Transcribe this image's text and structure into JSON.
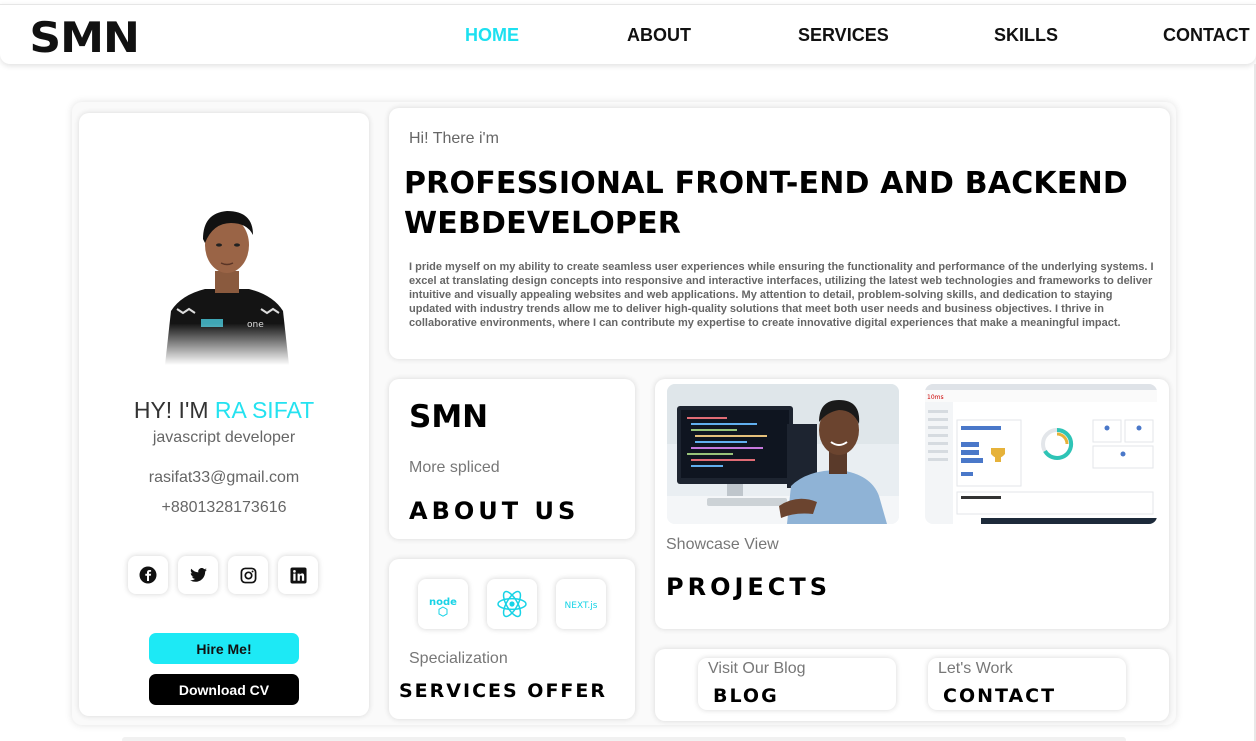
{
  "header": {
    "logo": "SMN",
    "nav": [
      {
        "label": "HOME",
        "active": true
      },
      {
        "label": "ABOUT",
        "active": false
      },
      {
        "label": "SERVICES",
        "active": false
      },
      {
        "label": "SKILLS",
        "active": false
      },
      {
        "label": "CONTACT",
        "active": false
      }
    ]
  },
  "profile": {
    "greeting_prefix": "HY! I'M ",
    "name": "RA SIFAT",
    "role": "javascript developer",
    "email": "rasifat33@gmail.com",
    "phone": "+8801328173616",
    "socials": [
      "facebook-icon",
      "twitter-icon",
      "instagram-icon",
      "linkedin-icon"
    ],
    "hire_label": "Hire Me!",
    "cv_label": "Download CV"
  },
  "intro": {
    "greeting": "Hi! There i'm",
    "headline": "PROFESSIONAL FRONT-END AND BACKEND WEBDEVELOPER",
    "bio": "I pride myself on my ability to create seamless user experiences while ensuring the functionality and performance of the underlying systems. I excel at translating design concepts into responsive and interactive interfaces, utilizing the latest web technologies and frameworks to deliver intuitive and visually appealing websites and web applications. My attention to detail, problem-solving skills, and dedication to staying updated with industry trends allow me to deliver high-quality solutions that meet both user needs and business objectives. I thrive in collaborative environments, where I can contribute my expertise to create innovative digital experiences that make a meaningful impact."
  },
  "about": {
    "brand": "SMN",
    "subtitle": "More spliced",
    "title": "ABOUT US"
  },
  "services": {
    "tech": [
      {
        "label": "node",
        "icon": "nodejs-icon"
      },
      {
        "label": "",
        "icon": "react-icon"
      },
      {
        "label": "NEXT.js",
        "icon": "nextjs-icon"
      }
    ],
    "subtitle": "Specialization",
    "title": "SERVICES OFFER"
  },
  "projects": {
    "subtitle": "Showcase View",
    "title": "PROJECTS"
  },
  "links": {
    "blog": {
      "subtitle": "Visit Our Blog",
      "title": "BLOG"
    },
    "contact": {
      "subtitle": "Let's Work",
      "title": "CONTACT"
    }
  },
  "colors": {
    "accent": "#1de0f0",
    "button_hire": "#1de9f5",
    "button_cv": "#000000"
  }
}
